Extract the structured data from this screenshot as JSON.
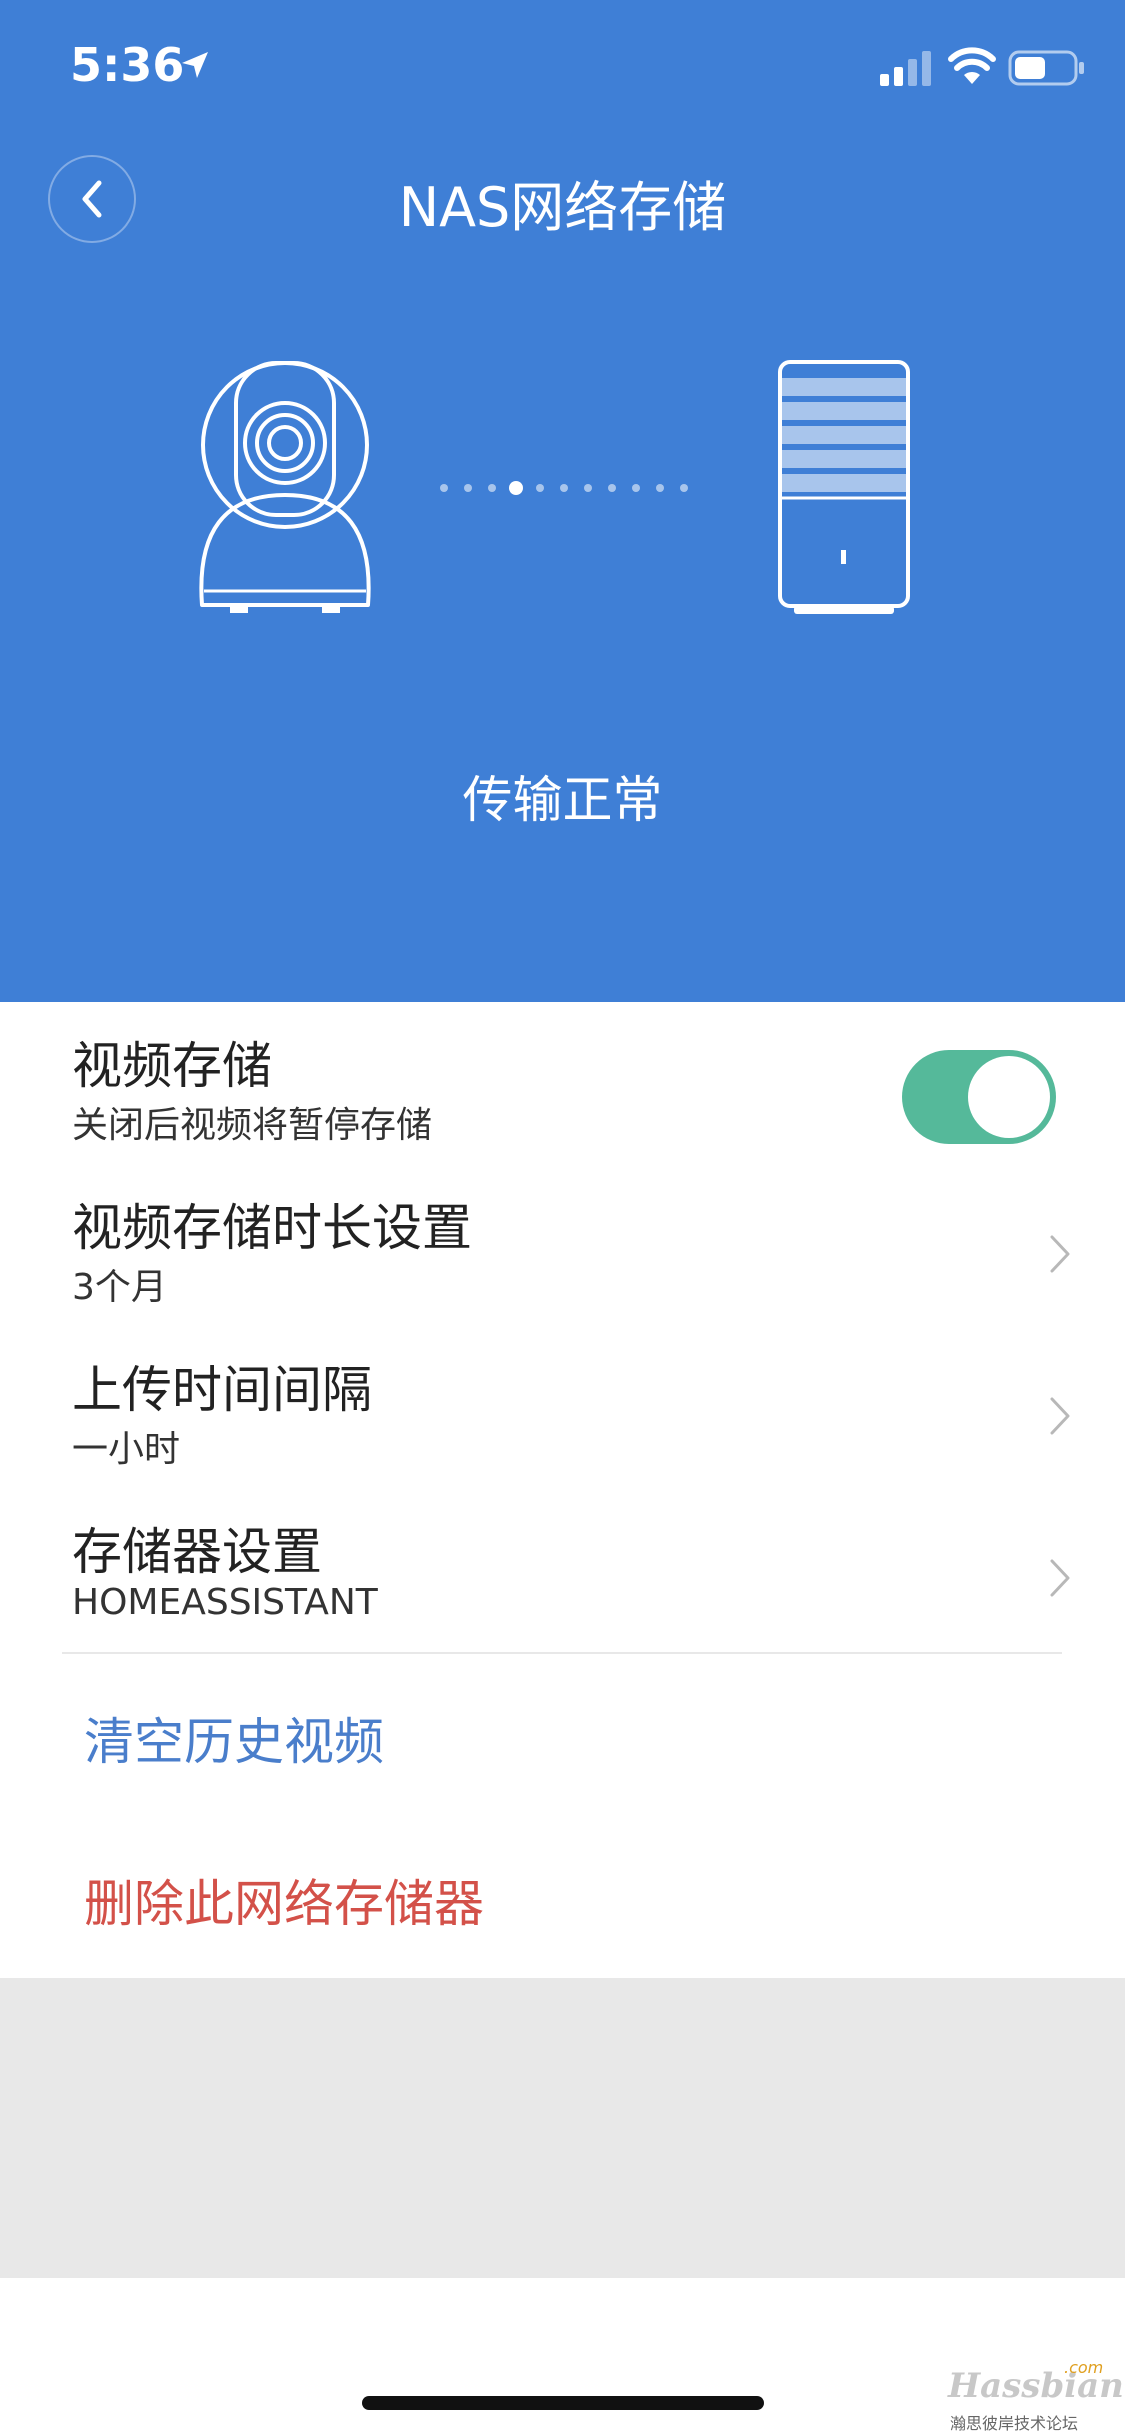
{
  "status_bar": {
    "time": "5:36"
  },
  "header": {
    "title": "NAS网络存储"
  },
  "connection": {
    "status_text": "传输正常",
    "active_dot_index": 3,
    "dot_count": 11
  },
  "settings": {
    "video_storage": {
      "title": "视频存储",
      "subtitle": "关闭后视频将暂停存储",
      "enabled": true
    },
    "retention": {
      "title": "视频存储时长设置",
      "value": "3个月"
    },
    "upload_interval": {
      "title": "上传时间间隔",
      "value": "一小时"
    },
    "storage_device": {
      "title": "存储器设置",
      "value": "HOMEASSISTANT"
    }
  },
  "actions": {
    "clear_history": "清空历史视频",
    "delete_storage": "删除此网络存储器"
  },
  "watermark": {
    "brand": "Hassbian",
    "domain": ".com",
    "tagline": "瀚思彼岸技术论坛"
  },
  "colors": {
    "header_bg": "#3f7fd6",
    "toggle_on": "#55b99a",
    "link_blue": "#4a7ecb",
    "danger_red": "#d35149"
  }
}
